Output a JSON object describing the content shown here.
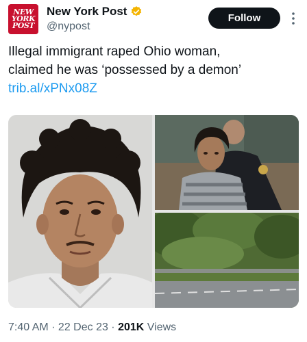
{
  "account": {
    "display_name": "New York Post",
    "handle": "@nypost",
    "avatar_lines": [
      "NEW",
      "YORK",
      "POST"
    ],
    "verified_color": "#f4b400"
  },
  "follow_button": {
    "label": "Follow"
  },
  "more_menu": {
    "icon": "more-vertical-icon"
  },
  "tweet": {
    "line1": "Illegal immigrant raped Ohio woman,",
    "line2": "claimed he was ‘possessed by a demon’",
    "link": "trib.al/xPNx08Z"
  },
  "media": {
    "images": [
      "mugshot-photo",
      "courtroom-photo",
      "roadside-photo"
    ]
  },
  "meta": {
    "time": "7:40 AM",
    "sep1": " · ",
    "date": "22 Dec 23",
    "sep2": " · ",
    "views_count": "201K",
    "views_label": " Views"
  },
  "colors": {
    "brand_red": "#c8102e",
    "link_blue": "#1d9bf0",
    "text_primary": "#0f1419",
    "text_secondary": "#536471"
  }
}
